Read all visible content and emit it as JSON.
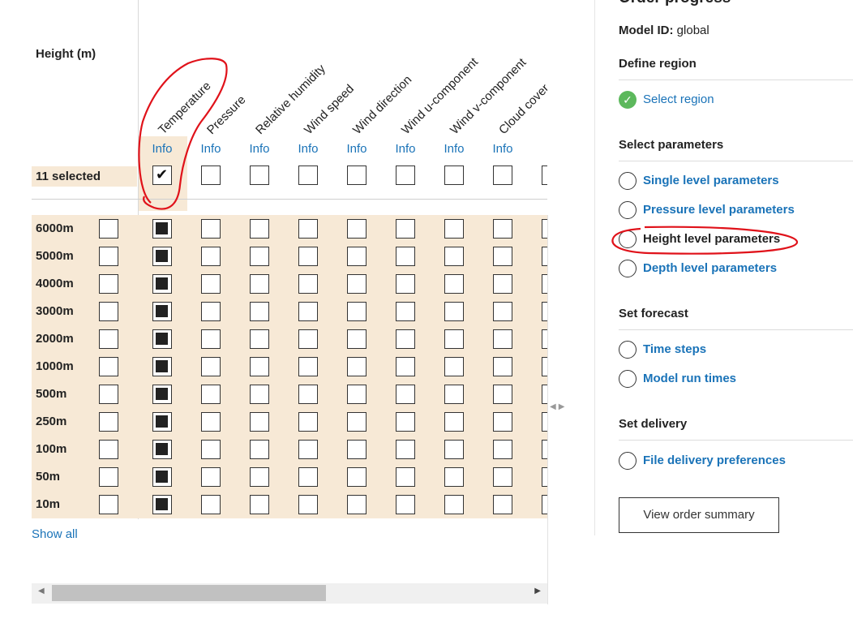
{
  "grid": {
    "height_header": "Height (m)",
    "selected_label": "11 selected",
    "info_label": "Info",
    "partial_info_label": "In",
    "parameters": [
      "Temperature",
      "Pressure",
      "Relative humidity",
      "Wind speed",
      "Wind direction",
      "Wind u-component",
      "Wind v-component",
      "Cloud cover"
    ],
    "heights": [
      "6000m",
      "5000m",
      "4000m",
      "3000m",
      "2000m",
      "1000m",
      "500m",
      "250m",
      "100m",
      "50m",
      "10m"
    ],
    "checked_parameter_index": 0,
    "show_all_label": "Show all"
  },
  "panel": {
    "title": "Order progress",
    "model_id_label": "Model ID:",
    "model_id_value": "global",
    "sections": [
      {
        "title": "Define region",
        "options": [
          {
            "label": "Select region",
            "state": "done"
          }
        ]
      },
      {
        "title": "Select parameters",
        "options": [
          {
            "label": "Single level parameters",
            "state": "pending"
          },
          {
            "label": "Pressure level parameters",
            "state": "pending"
          },
          {
            "label": "Height level parameters",
            "state": "current"
          },
          {
            "label": "Depth level parameters",
            "state": "pending"
          }
        ]
      },
      {
        "title": "Set forecast",
        "options": [
          {
            "label": "Time steps",
            "state": "pending"
          },
          {
            "label": "Model run times",
            "state": "pending"
          }
        ]
      },
      {
        "title": "Set delivery",
        "options": [
          {
            "label": "File delivery preferences",
            "state": "pending"
          }
        ]
      }
    ],
    "summary_button": "View order summary"
  },
  "colors": {
    "accent_link": "#1a73b8",
    "highlight": "#f7e9d6",
    "done_green": "#5cb85c",
    "annotation_red": "#e0121a"
  }
}
